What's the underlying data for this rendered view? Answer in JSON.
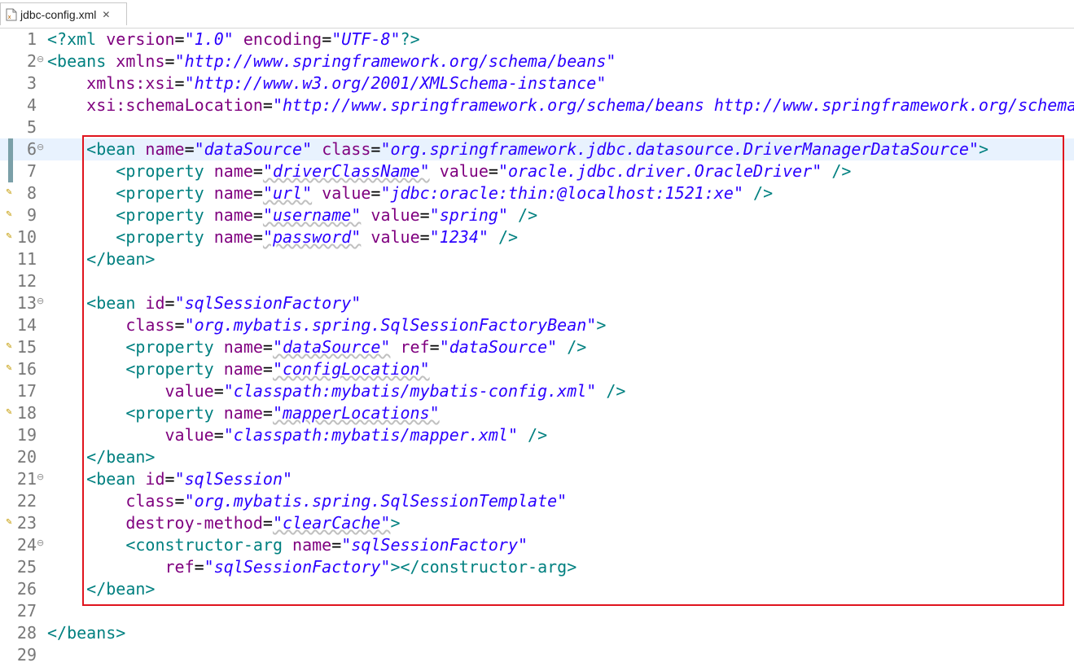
{
  "tab": {
    "title": "jdbc-config.xml",
    "close_glyph": "✕",
    "icon": "xml-file-icon"
  },
  "colors": {
    "tag": "#008080",
    "attr": "#7f007f",
    "value": "#2a00ff",
    "current_line": "#e8f2fe",
    "highlight_box": "#e0141e"
  },
  "current_line": 6,
  "highlight_box": {
    "from_line": 6,
    "to_line": 26
  },
  "lines": [
    {
      "n": 1,
      "fold": false,
      "marker": null,
      "tokens": [
        [
          "tag",
          "<?xml "
        ],
        [
          "attr",
          "version"
        ],
        [
          "punct",
          "="
        ],
        [
          "val",
          "\"1.0\""
        ],
        [
          "punct",
          " "
        ],
        [
          "attr",
          "encoding"
        ],
        [
          "punct",
          "="
        ],
        [
          "val",
          "\"UTF-8\""
        ],
        [
          "tag",
          "?>"
        ]
      ]
    },
    {
      "n": 2,
      "fold": true,
      "marker": null,
      "tokens": [
        [
          "tag",
          "<beans "
        ],
        [
          "attr",
          "xmlns"
        ],
        [
          "punct",
          "="
        ],
        [
          "val",
          "\"http://www.springframework.org/schema/beans\""
        ]
      ]
    },
    {
      "n": 3,
      "fold": false,
      "marker": null,
      "tokens": [
        [
          "punct",
          "    "
        ],
        [
          "attr",
          "xmlns:xsi"
        ],
        [
          "punct",
          "="
        ],
        [
          "val",
          "\"http://www.w3.org/2001/XMLSchema-instance\""
        ]
      ]
    },
    {
      "n": 4,
      "fold": false,
      "marker": null,
      "tokens": [
        [
          "punct",
          "    "
        ],
        [
          "attr",
          "xsi:schemaLocation"
        ],
        [
          "punct",
          "="
        ],
        [
          "val",
          "\"http://www.springframework.org/schema/beans http://www.springframework.org/schema/beans/spring-beans.xsd\">"
        ]
      ]
    },
    {
      "n": 5,
      "fold": false,
      "marker": null,
      "tokens": []
    },
    {
      "n": 6,
      "fold": true,
      "marker": "change",
      "tokens": [
        [
          "punct",
          "    "
        ],
        [
          "tag",
          "<bean "
        ],
        [
          "attr",
          "name"
        ],
        [
          "punct",
          "="
        ],
        [
          "val",
          "\"dataSource\""
        ],
        [
          "punct",
          " "
        ],
        [
          "attr",
          "class"
        ],
        [
          "punct",
          "="
        ],
        [
          "val",
          "\"org.springframework.jdbc.datasource.DriverManagerDataSource\""
        ],
        [
          "tag",
          ">"
        ]
      ]
    },
    {
      "n": 7,
      "fold": false,
      "marker": "change",
      "tokens": [
        [
          "punct",
          "       "
        ],
        [
          "tag",
          "<property "
        ],
        [
          "attr",
          "name"
        ],
        [
          "punct",
          "="
        ],
        [
          "valsq",
          "\"driverClassName\""
        ],
        [
          "punct",
          " "
        ],
        [
          "attr",
          "value"
        ],
        [
          "punct",
          "="
        ],
        [
          "val",
          "\"oracle.jdbc.driver.OracleDriver\""
        ],
        [
          "punct",
          " "
        ],
        [
          "tag",
          "/>"
        ]
      ]
    },
    {
      "n": 8,
      "fold": false,
      "marker": "warn",
      "tokens": [
        [
          "punct",
          "       "
        ],
        [
          "tag",
          "<property "
        ],
        [
          "attr",
          "name"
        ],
        [
          "punct",
          "="
        ],
        [
          "valsq",
          "\"url\""
        ],
        [
          "punct",
          " "
        ],
        [
          "attr",
          "value"
        ],
        [
          "punct",
          "="
        ],
        [
          "val",
          "\"jdbc:oracle:thin:@localhost:1521:xe\""
        ],
        [
          "punct",
          " "
        ],
        [
          "tag",
          "/>"
        ]
      ]
    },
    {
      "n": 9,
      "fold": false,
      "marker": "warn",
      "tokens": [
        [
          "punct",
          "       "
        ],
        [
          "tag",
          "<property "
        ],
        [
          "attr",
          "name"
        ],
        [
          "punct",
          "="
        ],
        [
          "valsq",
          "\"username\""
        ],
        [
          "punct",
          " "
        ],
        [
          "attr",
          "value"
        ],
        [
          "punct",
          "="
        ],
        [
          "val",
          "\"spring\""
        ],
        [
          "punct",
          " "
        ],
        [
          "tag",
          "/>"
        ]
      ]
    },
    {
      "n": 10,
      "fold": false,
      "marker": "warn",
      "tokens": [
        [
          "punct",
          "       "
        ],
        [
          "tag",
          "<property "
        ],
        [
          "attr",
          "name"
        ],
        [
          "punct",
          "="
        ],
        [
          "valsq",
          "\"password\""
        ],
        [
          "punct",
          " "
        ],
        [
          "attr",
          "value"
        ],
        [
          "punct",
          "="
        ],
        [
          "val",
          "\"1234\""
        ],
        [
          "punct",
          " "
        ],
        [
          "tag",
          "/>"
        ]
      ]
    },
    {
      "n": 11,
      "fold": false,
      "marker": null,
      "tokens": [
        [
          "punct",
          "    "
        ],
        [
          "tag",
          "</bean>"
        ]
      ]
    },
    {
      "n": 12,
      "fold": false,
      "marker": null,
      "tokens": []
    },
    {
      "n": 13,
      "fold": true,
      "marker": null,
      "tokens": [
        [
          "punct",
          "    "
        ],
        [
          "tag",
          "<bean "
        ],
        [
          "attr",
          "id"
        ],
        [
          "punct",
          "="
        ],
        [
          "val",
          "\"sqlSessionFactory\""
        ]
      ]
    },
    {
      "n": 14,
      "fold": false,
      "marker": null,
      "tokens": [
        [
          "punct",
          "        "
        ],
        [
          "attr",
          "class"
        ],
        [
          "punct",
          "="
        ],
        [
          "val",
          "\"org.mybatis.spring.SqlSessionFactoryBean\""
        ],
        [
          "tag",
          ">"
        ]
      ]
    },
    {
      "n": 15,
      "fold": false,
      "marker": "warn",
      "tokens": [
        [
          "punct",
          "        "
        ],
        [
          "tag",
          "<property "
        ],
        [
          "attr",
          "name"
        ],
        [
          "punct",
          "="
        ],
        [
          "valsq",
          "\"dataSource\""
        ],
        [
          "punct",
          " "
        ],
        [
          "attr",
          "ref"
        ],
        [
          "punct",
          "="
        ],
        [
          "val",
          "\"dataSource\""
        ],
        [
          "punct",
          " "
        ],
        [
          "tag",
          "/>"
        ]
      ]
    },
    {
      "n": 16,
      "fold": false,
      "marker": "warn",
      "tokens": [
        [
          "punct",
          "        "
        ],
        [
          "tag",
          "<property "
        ],
        [
          "attr",
          "name"
        ],
        [
          "punct",
          "="
        ],
        [
          "valsq",
          "\"configLocation\""
        ]
      ]
    },
    {
      "n": 17,
      "fold": false,
      "marker": null,
      "tokens": [
        [
          "punct",
          "            "
        ],
        [
          "attr",
          "value"
        ],
        [
          "punct",
          "="
        ],
        [
          "val",
          "\"classpath:mybatis/mybatis-config.xml\""
        ],
        [
          "punct",
          " "
        ],
        [
          "tag",
          "/>"
        ]
      ]
    },
    {
      "n": 18,
      "fold": false,
      "marker": "warn",
      "tokens": [
        [
          "punct",
          "        "
        ],
        [
          "tag",
          "<property "
        ],
        [
          "attr",
          "name"
        ],
        [
          "punct",
          "="
        ],
        [
          "valsq",
          "\"mapperLocations\""
        ]
      ]
    },
    {
      "n": 19,
      "fold": false,
      "marker": null,
      "tokens": [
        [
          "punct",
          "            "
        ],
        [
          "attr",
          "value"
        ],
        [
          "punct",
          "="
        ],
        [
          "val",
          "\"classpath:mybatis/mapper.xml\""
        ],
        [
          "punct",
          " "
        ],
        [
          "tag",
          "/>"
        ]
      ]
    },
    {
      "n": 20,
      "fold": false,
      "marker": null,
      "tokens": [
        [
          "punct",
          "    "
        ],
        [
          "tag",
          "</bean>"
        ]
      ]
    },
    {
      "n": 21,
      "fold": true,
      "marker": null,
      "tokens": [
        [
          "punct",
          "    "
        ],
        [
          "tag",
          "<bean "
        ],
        [
          "attr",
          "id"
        ],
        [
          "punct",
          "="
        ],
        [
          "val",
          "\"sqlSession\""
        ]
      ]
    },
    {
      "n": 22,
      "fold": false,
      "marker": null,
      "tokens": [
        [
          "punct",
          "        "
        ],
        [
          "attr",
          "class"
        ],
        [
          "punct",
          "="
        ],
        [
          "val",
          "\"org.mybatis.spring.SqlSessionTemplate\""
        ]
      ]
    },
    {
      "n": 23,
      "fold": false,
      "marker": "warn",
      "tokens": [
        [
          "punct",
          "        "
        ],
        [
          "attr",
          "destroy-method"
        ],
        [
          "punct",
          "="
        ],
        [
          "valsq",
          "\"clearCache\""
        ],
        [
          "tag",
          ">"
        ]
      ]
    },
    {
      "n": 24,
      "fold": true,
      "marker": null,
      "tokens": [
        [
          "punct",
          "        "
        ],
        [
          "tag",
          "<constructor-arg "
        ],
        [
          "attr",
          "name"
        ],
        [
          "punct",
          "="
        ],
        [
          "val",
          "\"sqlSessionFactory\""
        ]
      ]
    },
    {
      "n": 25,
      "fold": false,
      "marker": null,
      "tokens": [
        [
          "punct",
          "            "
        ],
        [
          "attr",
          "ref"
        ],
        [
          "punct",
          "="
        ],
        [
          "val",
          "\"sqlSessionFactory\""
        ],
        [
          "tag",
          "></constructor-arg>"
        ]
      ]
    },
    {
      "n": 26,
      "fold": false,
      "marker": null,
      "tokens": [
        [
          "punct",
          "    "
        ],
        [
          "tag",
          "</bean>"
        ]
      ]
    },
    {
      "n": 27,
      "fold": false,
      "marker": null,
      "tokens": []
    },
    {
      "n": 28,
      "fold": false,
      "marker": null,
      "tokens": [
        [
          "tag",
          "</beans>"
        ]
      ]
    },
    {
      "n": 29,
      "fold": false,
      "marker": null,
      "tokens": []
    }
  ]
}
